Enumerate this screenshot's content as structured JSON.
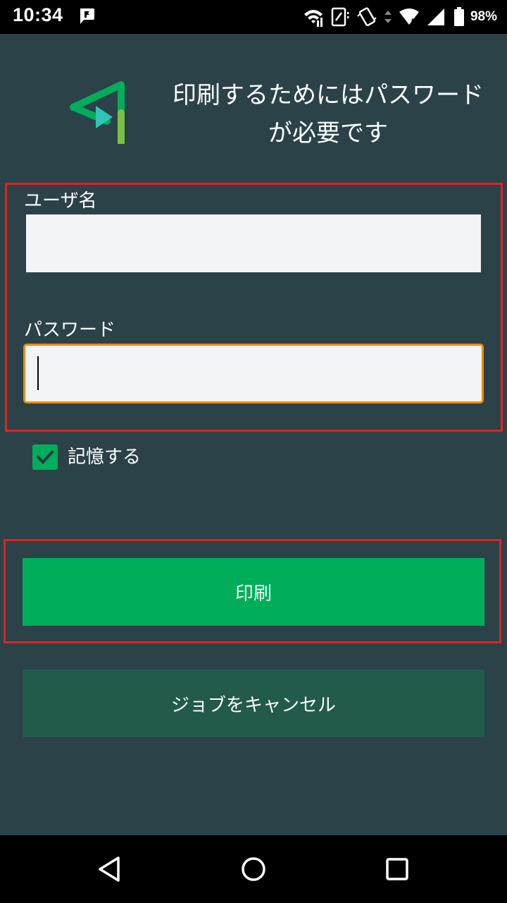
{
  "status_bar": {
    "time": "10:34",
    "battery_text": "98%",
    "icons": [
      "notification-flag-icon",
      "wifi-icon",
      "nfc-icon",
      "vibrate-icon",
      "data-arrows-icon",
      "wifi-5-icon",
      "signal-icon",
      "battery-icon"
    ]
  },
  "header": {
    "title": "印刷するためにはパスワードが必要です",
    "logo_icon": "app-logo-icon"
  },
  "form": {
    "username_label": "ユーザ名",
    "username_value": "",
    "password_label": "パスワード",
    "password_value": ""
  },
  "remember": {
    "label": "記憶する",
    "checked": true
  },
  "buttons": {
    "print_label": "印刷",
    "cancel_label": "ジョブをキャンセル"
  },
  "colors": {
    "background": "#2b4248",
    "primary": "#00ad5b",
    "secondary": "#225a4b",
    "focus": "#f08a00",
    "highlight": "#e0241c"
  },
  "nav_bar": {
    "icons": [
      "back-icon",
      "home-icon",
      "recent-apps-icon"
    ]
  }
}
